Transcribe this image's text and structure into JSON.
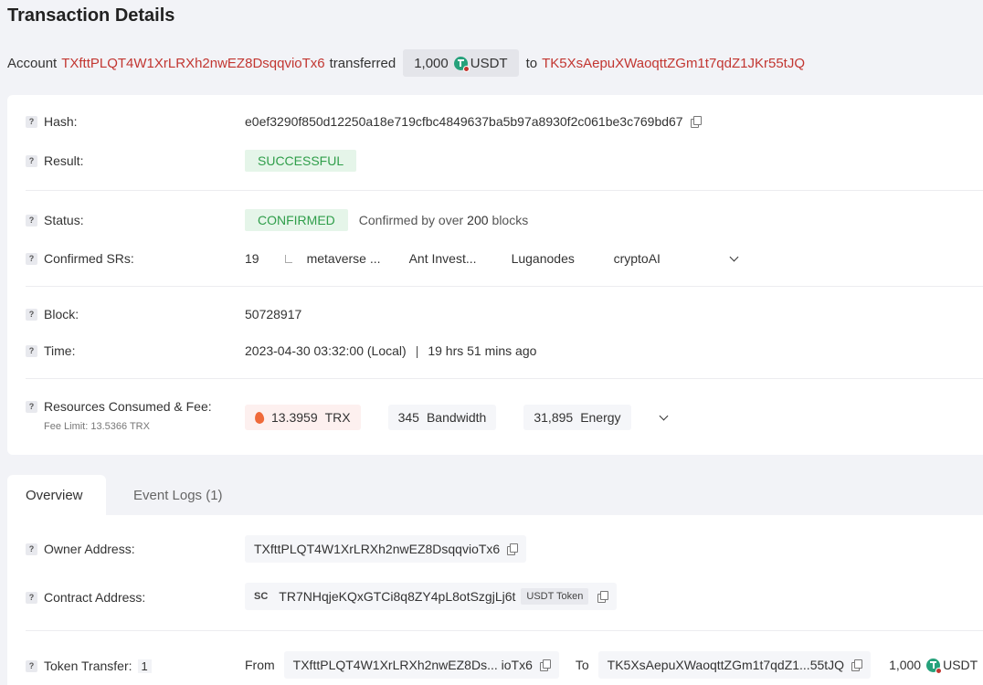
{
  "header": {
    "title": "Transaction Details",
    "summary": {
      "prefix": "Account",
      "from": "TXfttPLQT4W1XrLRXh2nwEZ8DsqqvioTx6",
      "verb": "transferred",
      "amount": "1,000",
      "token": "USDT",
      "to_word": "to",
      "to": "TK5XsAepuXWaoqttZGm1t7qdZ1JKr55tJQ"
    }
  },
  "details": {
    "hash": {
      "label": "Hash:",
      "value": "e0ef3290f850d12250a18e719cfbc4849637ba5b97a8930f2c061be3c769bd67"
    },
    "result": {
      "label": "Result:",
      "value": "SUCCESSFUL"
    },
    "status": {
      "label": "Status:",
      "value": "CONFIRMED",
      "note_prefix": "Confirmed by over",
      "note_count": "200",
      "note_suffix": "blocks"
    },
    "confirmed_srs": {
      "label": "Confirmed SRs:",
      "count": "19",
      "items": [
        "metaverse ...",
        "Ant Invest...",
        "Luganodes",
        "cryptoAI"
      ]
    },
    "block": {
      "label": "Block:",
      "value": "50728917"
    },
    "time": {
      "label": "Time:",
      "value": "2023-04-30 03:32:00 (Local)",
      "separator": "|",
      "ago": "19 hrs 51 mins ago"
    },
    "resources": {
      "label": "Resources Consumed & Fee:",
      "fee_limit": "Fee Limit: 13.5366 TRX",
      "trx_amount": "13.3959",
      "trx_unit": "TRX",
      "bandwidth_amount": "345",
      "bandwidth_unit": "Bandwidth",
      "energy_amount": "31,895",
      "energy_unit": "Energy"
    }
  },
  "tabs": [
    {
      "label": "Overview",
      "active": true
    },
    {
      "label": "Event Logs (1)",
      "active": false
    }
  ],
  "overview": {
    "owner": {
      "label": "Owner Address:",
      "value": "TXfttPLQT4W1XrLRXh2nwEZ8DsqqvioTx6"
    },
    "contract": {
      "label": "Contract Address:",
      "sc": "SC",
      "value": "TR7NHqjeKQxGTCi8q8ZY4pL8otSzgjLj6t",
      "tag": "USDT Token"
    },
    "token_transfer": {
      "label": "Token Transfer:",
      "count": "1",
      "from_word": "From",
      "from": "TXfttPLQT4W1XrLRXh2nwEZ8Ds... ioTx6",
      "to_word": "To",
      "to": "TK5XsAepuXWaoqttZGm1t7qdZ1...55tJQ",
      "amount": "1,000",
      "token": "USDT"
    }
  },
  "colors": {
    "address_red": "#c23631",
    "success_green": "#2f9e4a",
    "success_bg": "#e5f5e9"
  }
}
